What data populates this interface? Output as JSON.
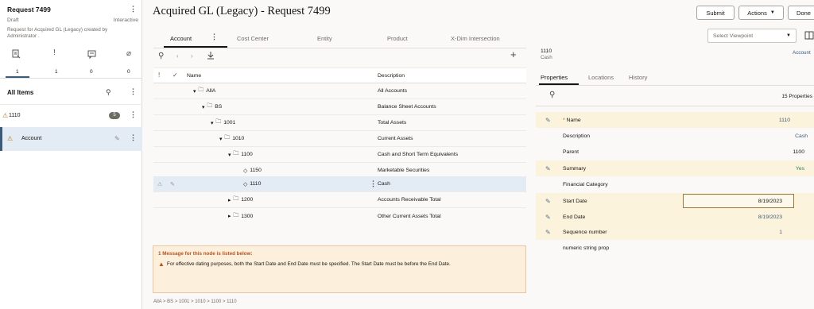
{
  "left": {
    "request_title": "Request 7499",
    "status": "Draft",
    "mode": "Interactive",
    "description": "Request for Acquired GL (Legacy) created by Administrator .",
    "stats": [
      {
        "icon": "request-items-icon",
        "count": "1"
      },
      {
        "icon": "exclamation-icon",
        "count": "1"
      },
      {
        "icon": "comment-icon",
        "count": "0"
      },
      {
        "icon": "paperclip-icon",
        "count": "0"
      }
    ],
    "all_items_label": "All Items",
    "items": [
      {
        "label": "1110",
        "badge": "5"
      },
      {
        "label": "Account"
      }
    ]
  },
  "header": {
    "title": "Acquired GL (Legacy) - Request 7499",
    "submit_label": "Submit",
    "actions_label": "Actions",
    "done_label": "Done"
  },
  "tabs": [
    "Account",
    "Cost Center",
    "Entity",
    "Product",
    "X-Dim Intersection"
  ],
  "viewpoint_placeholder": "Select Viewpoint",
  "grid": {
    "col_description": "Description",
    "rows": [
      {
        "name": "AllA",
        "desc": "All Accounts",
        "type": "folder",
        "exp": "open"
      },
      {
        "name": "BS",
        "desc": "Balance Sheet Accounts",
        "type": "folder",
        "exp": "open"
      },
      {
        "name": "1001",
        "desc": "Total Assets",
        "type": "folder",
        "exp": "open"
      },
      {
        "name": "1010",
        "desc": "Current Assets",
        "type": "folder",
        "exp": "open"
      },
      {
        "name": "1100",
        "desc": "Cash and Short Term Equivalents",
        "type": "folder",
        "exp": "open"
      },
      {
        "name": "1150",
        "desc": "Marketable Securities",
        "type": "leaf",
        "exp": "none"
      },
      {
        "name": "1110",
        "desc": "Cash",
        "type": "leaf",
        "exp": "none"
      },
      {
        "name": "1200",
        "desc": "Accounts Receivable Total",
        "type": "folder",
        "exp": "closed"
      },
      {
        "name": "1300",
        "desc": "Other Current Assets Total",
        "type": "folder",
        "exp": "closed"
      }
    ]
  },
  "message": {
    "title": "1 Message for this node is listed below:",
    "text": "For effective dating purposes, both the Start Date and End Date must be specified. The Start Date must be before the End Date."
  },
  "breadcrumb": "AllA > BS > 1001 > 1010 > 1100 > 1110",
  "inspector": {
    "node_name": "1110",
    "node_desc": "Cash",
    "link": "Account",
    "tabs": [
      "Properties",
      "Locations",
      "History"
    ],
    "properties_count": "15 Properties",
    "properties": [
      {
        "label": "Name",
        "value": "1110",
        "required": true,
        "editable": true
      },
      {
        "label": "Description",
        "value": "Cash",
        "editable": false
      },
      {
        "label": "Parent",
        "value": "1100",
        "editable": false
      },
      {
        "label": "Summary",
        "value": "Yes",
        "editable": true
      },
      {
        "label": "Financial Category",
        "value": "",
        "editable": false
      },
      {
        "label": "Start Date",
        "value": "8/19/2023",
        "editable": true
      },
      {
        "label": "End Date",
        "value": "8/19/2023",
        "editable": true
      },
      {
        "label": "Sequence number",
        "value": "1",
        "editable": true
      },
      {
        "label": "numeric string prop",
        "value": "",
        "editable": false
      }
    ]
  },
  "colors": {
    "highlight": "#fcf3dc",
    "selected": "#e3ecf4",
    "accent": "#3b5b7a",
    "warning": "#b9531b",
    "message_bg": "#fcefdc"
  }
}
